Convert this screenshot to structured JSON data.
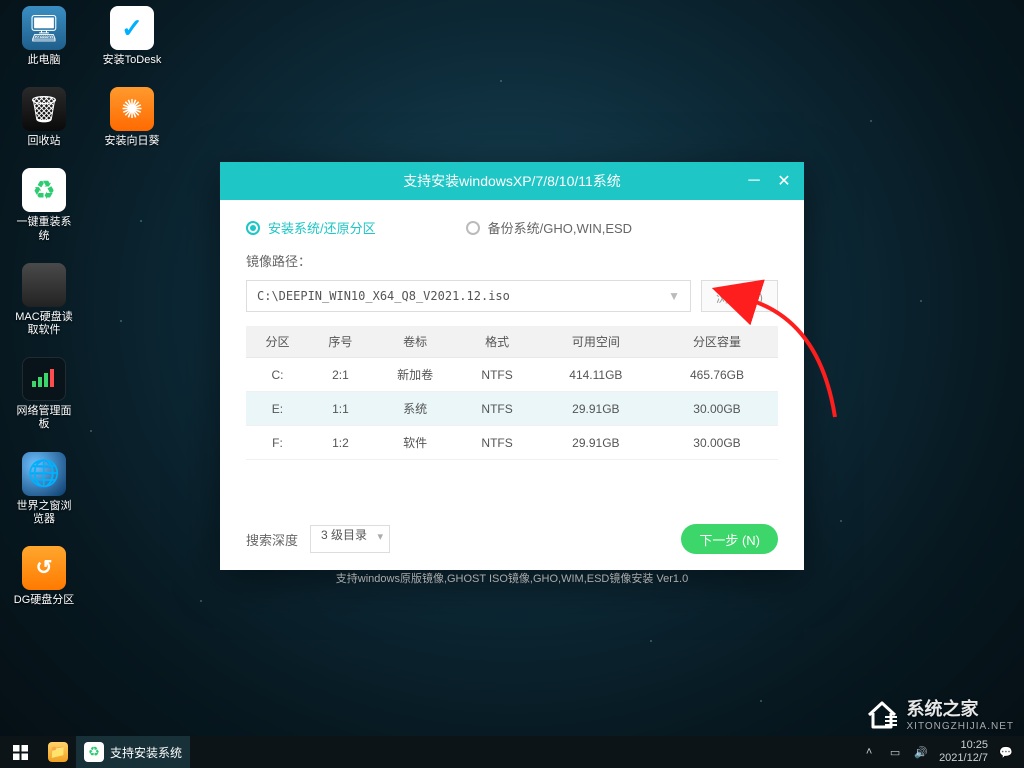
{
  "desktop_icons": {
    "row1": [
      {
        "id": "this-pc",
        "label": "此电脑"
      },
      {
        "id": "todesk",
        "label": "安装ToDesk"
      }
    ],
    "col": [
      {
        "id": "recycle",
        "label": "回收站",
        "pair": {
          "id": "sunflower",
          "label": "安装向日葵"
        }
      },
      {
        "id": "reinstall",
        "label": "一键重装系统"
      },
      {
        "id": "mac-disk",
        "label": "MAC硬盘读取软件"
      },
      {
        "id": "net-panel",
        "label": "网络管理面板"
      },
      {
        "id": "world-browser",
        "label": "世界之窗浏览器"
      },
      {
        "id": "dg-part",
        "label": "DG硬盘分区"
      }
    ]
  },
  "dialog": {
    "title": "支持安装windowsXP/7/8/10/11系统",
    "radio_install": "安装系统/还原分区",
    "radio_backup": "备份系统/GHO,WIN,ESD",
    "path_label": "镜像路径：",
    "path_value": "C:\\DEEPIN_WIN10_X64_Q8_V2021.12.iso",
    "browse_label": "浏览 (B)",
    "table": {
      "headers": [
        "分区",
        "序号",
        "卷标",
        "格式",
        "可用空间",
        "分区容量"
      ],
      "rows": [
        {
          "cells": [
            "C:",
            "2:1",
            "新加卷",
            "NTFS",
            "414.11GB",
            "465.76GB"
          ],
          "selected": false
        },
        {
          "cells": [
            "E:",
            "1:1",
            "系统",
            "NTFS",
            "29.91GB",
            "30.00GB"
          ],
          "selected": true
        },
        {
          "cells": [
            "F:",
            "1:2",
            "软件",
            "NTFS",
            "29.91GB",
            "30.00GB"
          ],
          "selected": false
        }
      ]
    },
    "depth_label": "搜索深度",
    "depth_value": "3 级目录",
    "next_label": "下一步 (N)",
    "footer": "支持windows原版镜像,GHOST ISO镜像,GHO,WIM,ESD镜像安装 Ver1.0"
  },
  "taskbar": {
    "file_explorer": "",
    "active_app": "支持安装系统",
    "time": "10:25",
    "date": "2021/12/7"
  },
  "watermark": {
    "text": "系统之家",
    "sub": "XITONGZHIJIA.NET"
  },
  "colors": {
    "accent": "#1ec6c6",
    "next": "#3cd66a",
    "arrow": "#ff1e1e"
  }
}
